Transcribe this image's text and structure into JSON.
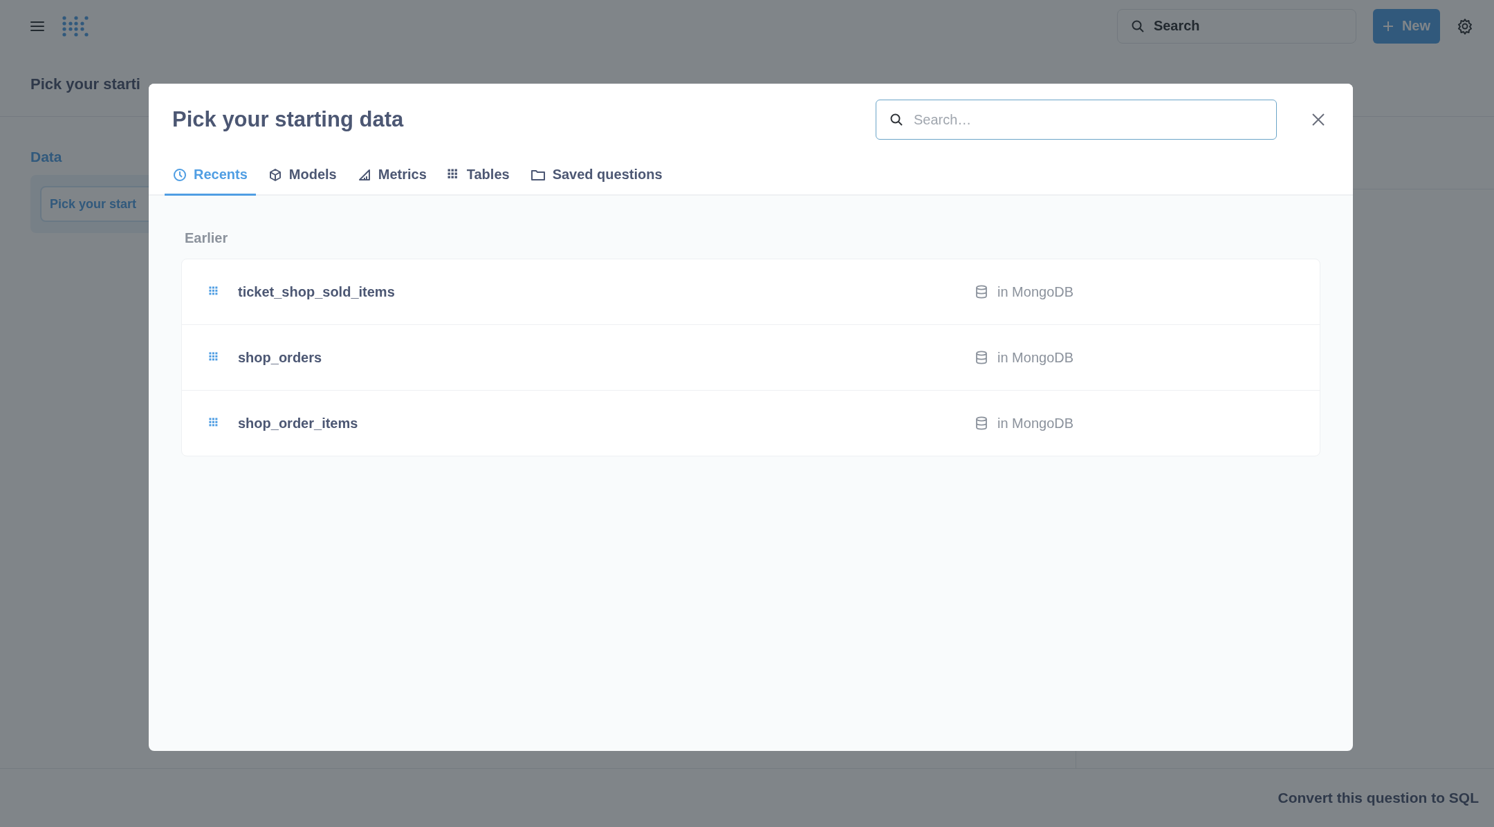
{
  "topbar": {
    "search": {
      "placeholder": "Search"
    },
    "new_button": "New"
  },
  "page": {
    "title": "Pick your starti",
    "section_label": "Data",
    "picker_button": "Pick your start",
    "convert_link": "Convert this question to SQL"
  },
  "modal": {
    "title": "Pick your starting data",
    "search": {
      "placeholder": "Search…"
    },
    "tabs": [
      {
        "label": "Recents",
        "selected": true,
        "kind": "recents"
      },
      {
        "label": "Models",
        "selected": false,
        "kind": "models"
      },
      {
        "label": "Metrics",
        "selected": false,
        "kind": "metrics"
      },
      {
        "label": "Tables",
        "selected": false,
        "kind": "tables"
      },
      {
        "label": "Saved questions",
        "selected": false,
        "kind": "questions"
      }
    ],
    "group_label": "Earlier",
    "items": [
      {
        "name": "ticket_shop_sold_items",
        "location": "in MongoDB"
      },
      {
        "name": "shop_orders",
        "location": "in MongoDB"
      },
      {
        "name": "shop_order_items",
        "location": "in MongoDB"
      }
    ]
  }
}
